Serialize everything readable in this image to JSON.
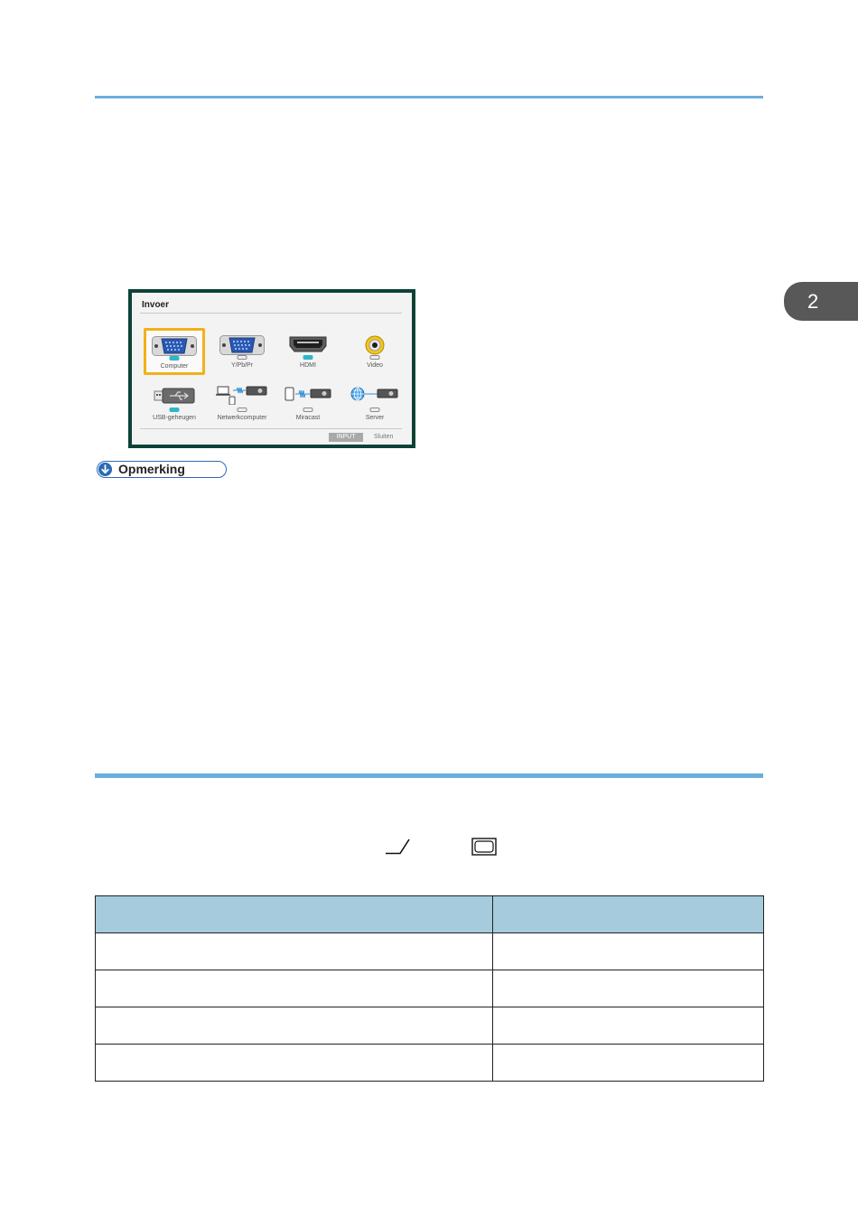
{
  "chapter_tab": {
    "number": "2"
  },
  "input_menu": {
    "title": "Invoer",
    "items": [
      {
        "label": "Computer",
        "icon": "vga-port-icon",
        "led_on": true,
        "selected": true
      },
      {
        "label": "Y/Pb/Pr",
        "icon": "vga-port-icon",
        "led_on": false,
        "selected": false
      },
      {
        "label": "HDMI",
        "icon": "hdmi-port-icon",
        "led_on": true,
        "selected": false
      },
      {
        "label": "Video",
        "icon": "rca-video-port-icon",
        "led_on": false,
        "selected": false
      },
      {
        "label": "USB-geheugen",
        "icon": "usb-memory-icon",
        "led_on": true,
        "selected": false
      },
      {
        "label": "Netwerkcomputer",
        "icon": "network-computer-icon",
        "led_on": false,
        "selected": false
      },
      {
        "label": "Miracast",
        "icon": "miracast-icon",
        "led_on": false,
        "selected": false
      },
      {
        "label": "Server",
        "icon": "server-icon",
        "led_on": false,
        "selected": false
      }
    ],
    "footer": {
      "input_key": "INPUT",
      "close_label": "Sluiten"
    },
    "colors": {
      "frame": "#0d4237",
      "selection": "#f2b019",
      "led_on": "#2fb6c9"
    }
  },
  "note": {
    "label": "Opmerking",
    "icon": "arrow-down-circle-icon"
  },
  "inline_symbols": [
    "checkmark-icon",
    "screen-icon"
  ],
  "table": {
    "headers": [
      "",
      ""
    ],
    "rows": [
      [
        "",
        ""
      ],
      [
        "",
        ""
      ],
      [
        "",
        ""
      ],
      [
        "",
        ""
      ]
    ]
  }
}
